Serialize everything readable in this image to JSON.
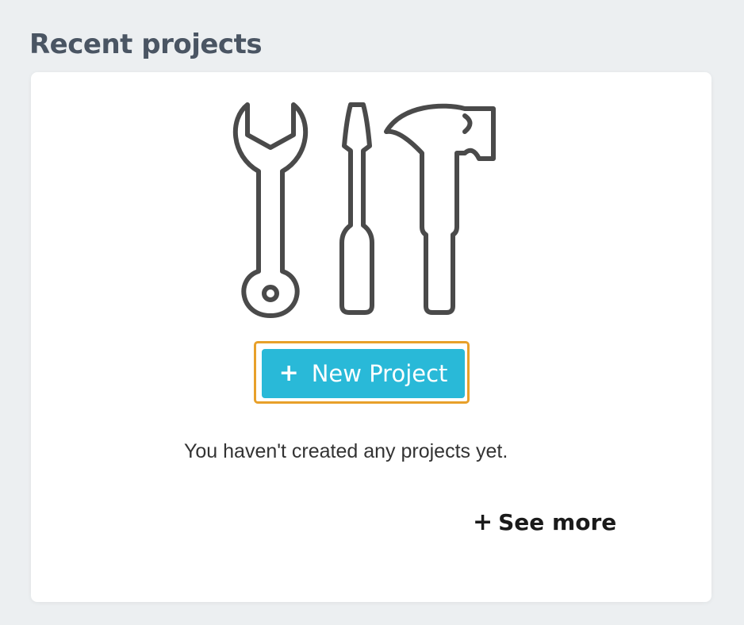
{
  "section": {
    "title": "Recent projects"
  },
  "card": {
    "illustration": {
      "icons": [
        "wrench-icon",
        "screwdriver-icon",
        "hammer-icon"
      ],
      "stroke_color": "#4a4a4a"
    },
    "new_project_button": {
      "icon": "plus-icon",
      "label": "New Project",
      "background": "#29b9d8",
      "highlight_border": "#e8a02a"
    },
    "empty_message": "You haven't created any projects yet.",
    "see_more": {
      "icon": "plus-icon",
      "label": "See more"
    }
  }
}
